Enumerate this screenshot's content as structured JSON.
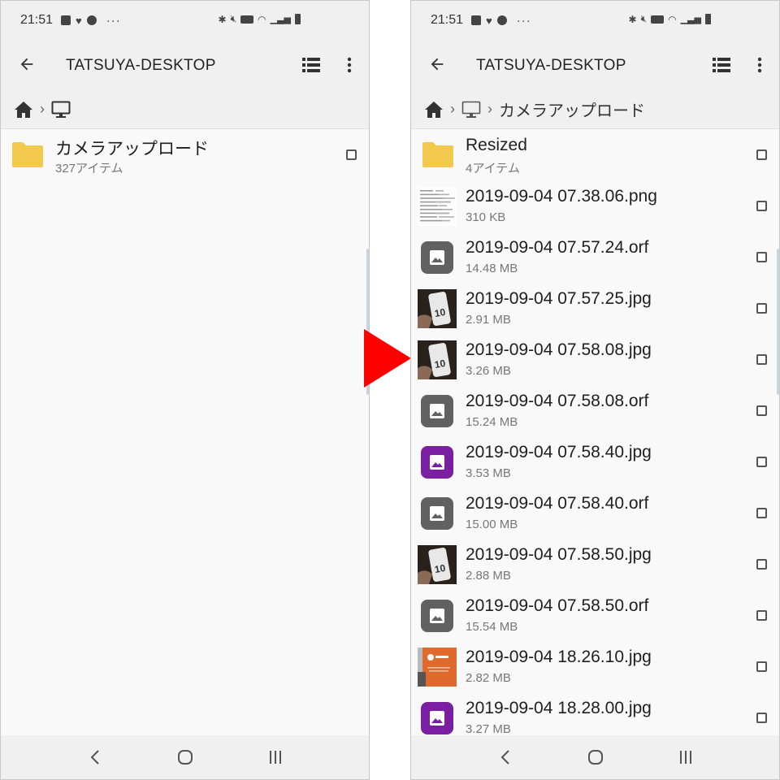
{
  "colors": {
    "arrow": "#ff0000",
    "folder": "#f2c94c",
    "generic_image_icon": "#616161",
    "purple_image_icon": "#7b1fa2"
  },
  "status": {
    "time": "21:51"
  },
  "left": {
    "title": "TATSUYA-DESKTOP",
    "items": [
      {
        "name": "カメラアップロード",
        "meta": "327アイテム",
        "icon": "folder-icon"
      }
    ]
  },
  "right": {
    "title": "TATSUYA-DESKTOP",
    "breadcrumb_folder": "カメラアップロード",
    "items": [
      {
        "name": "Resized",
        "meta": "4アイテム",
        "icon": "folder-icon"
      },
      {
        "name": "2019-09-04 07.38.06.png",
        "meta": "310 KB",
        "icon": "document-thumbnail"
      },
      {
        "name": "2019-09-04 07.57.24.orf",
        "meta": "14.48 MB",
        "icon": "image-icon"
      },
      {
        "name": "2019-09-04 07.57.25.jpg",
        "meta": "2.91 MB",
        "icon": "phone-photo-thumbnail"
      },
      {
        "name": "2019-09-04 07.58.08.jpg",
        "meta": "3.26 MB",
        "icon": "phone-photo-thumbnail"
      },
      {
        "name": "2019-09-04 07.58.08.orf",
        "meta": "15.24 MB",
        "icon": "image-icon"
      },
      {
        "name": "2019-09-04 07.58.40.jpg",
        "meta": "3.53 MB",
        "icon": "purple-image-icon"
      },
      {
        "name": "2019-09-04 07.58.40.orf",
        "meta": "15.00 MB",
        "icon": "image-icon"
      },
      {
        "name": "2019-09-04 07.58.50.jpg",
        "meta": "2.88 MB",
        "icon": "phone-photo-thumbnail"
      },
      {
        "name": "2019-09-04 07.58.50.orf",
        "meta": "15.54 MB",
        "icon": "image-icon"
      },
      {
        "name": "2019-09-04 18.26.10.jpg",
        "meta": "2.82 MB",
        "icon": "avast-photo-thumbnail"
      },
      {
        "name": "2019-09-04 18.28.00.jpg",
        "meta": "3.27 MB",
        "icon": "purple-image-icon"
      }
    ]
  }
}
